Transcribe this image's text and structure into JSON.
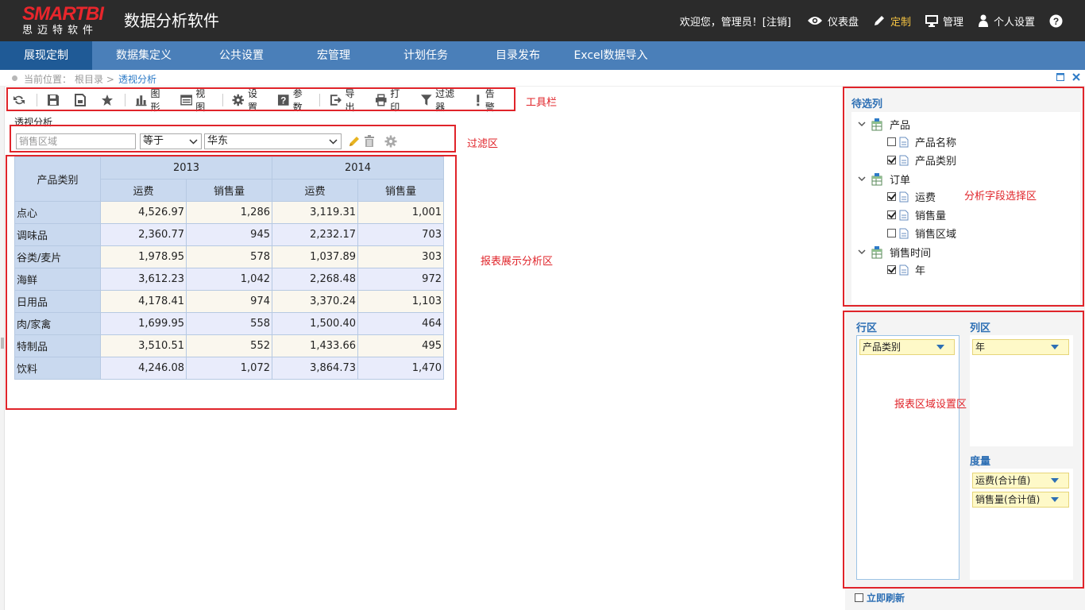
{
  "brand": {
    "logo_text": "SMARTBI",
    "logo_sub": "思迈特软件",
    "app_title": "数据分析软件"
  },
  "header": {
    "welcome": "欢迎您，管理员！[注销]",
    "items": [
      {
        "label": "仪表盘",
        "icon": "eye-icon"
      },
      {
        "label": "定制",
        "icon": "pencil-icon",
        "active": true
      },
      {
        "label": "管理",
        "icon": "monitor-icon"
      },
      {
        "label": "个人设置",
        "icon": "user-icon"
      }
    ],
    "help_icon": "help-icon"
  },
  "nav": [
    {
      "label": "展现定制",
      "active": true,
      "width": 116
    },
    {
      "label": "数据集定义",
      "width": 130
    },
    {
      "label": "公共设置",
      "width": 116
    },
    {
      "label": "宏管理",
      "width": 116
    },
    {
      "label": "计划任务",
      "width": 116
    },
    {
      "label": "目录发布",
      "width": 116
    },
    {
      "label": "Excel数据导入",
      "width": 118
    }
  ],
  "breadcrumb": {
    "label": "当前位置：",
    "root": "根目录 >",
    "current": "透视分析"
  },
  "toolbar": {
    "chart": "图形",
    "view": "视图",
    "settings": "设置",
    "params": "参数",
    "export": "导出",
    "print": "打印",
    "filter": "过滤器",
    "alert": "告警"
  },
  "view_title": "透视分析",
  "filter": {
    "field_placeholder": "销售区域",
    "operator": "等于",
    "value": "华东"
  },
  "annotations": {
    "toolbar": "工具栏",
    "filter": "过滤区",
    "report": "报表展示分析区",
    "fields": "分析字段选择区",
    "zones": "报表区域设置区"
  },
  "table": {
    "row_header": "产品类别",
    "years": [
      "2013",
      "2014"
    ],
    "measures": [
      "运费",
      "销售量"
    ],
    "rows": [
      {
        "name": "点心",
        "values": [
          "4,526.97",
          "1,286",
          "3,119.31",
          "1,001"
        ]
      },
      {
        "name": "调味品",
        "values": [
          "2,360.77",
          "945",
          "2,232.17",
          "703"
        ]
      },
      {
        "name": "谷类/麦片",
        "values": [
          "1,978.95",
          "578",
          "1,037.89",
          "303"
        ]
      },
      {
        "name": "海鲜",
        "values": [
          "3,612.23",
          "1,042",
          "2,268.48",
          "972"
        ]
      },
      {
        "name": "日用品",
        "values": [
          "4,178.41",
          "974",
          "3,370.24",
          "1,103"
        ]
      },
      {
        "name": "肉/家禽",
        "values": [
          "1,699.95",
          "558",
          "1,500.40",
          "464"
        ]
      },
      {
        "name": "特制品",
        "values": [
          "3,510.51",
          "552",
          "1,433.66",
          "495"
        ]
      },
      {
        "name": "饮料",
        "values": [
          "4,246.08",
          "1,072",
          "3,864.73",
          "1,470"
        ]
      }
    ]
  },
  "fields_panel": {
    "title": "待选列",
    "groups": [
      {
        "label": "产品",
        "children": [
          {
            "label": "产品名称",
            "checked": false
          },
          {
            "label": "产品类别",
            "checked": true
          }
        ]
      },
      {
        "label": "订单",
        "children": [
          {
            "label": "运费",
            "checked": true
          },
          {
            "label": "销售量",
            "checked": true
          },
          {
            "label": "销售区域",
            "checked": false
          }
        ]
      },
      {
        "label": "销售时间",
        "children": [
          {
            "label": "年",
            "checked": true
          }
        ]
      }
    ]
  },
  "zones": {
    "row_title": "行区",
    "col_title": "列区",
    "measure_title": "度量",
    "row_items": [
      "产品类别"
    ],
    "col_items": [
      "年"
    ],
    "measure_items": [
      "运费(合计值)",
      "销售量(合计值)"
    ]
  },
  "refresh_label": "立即刷新"
}
